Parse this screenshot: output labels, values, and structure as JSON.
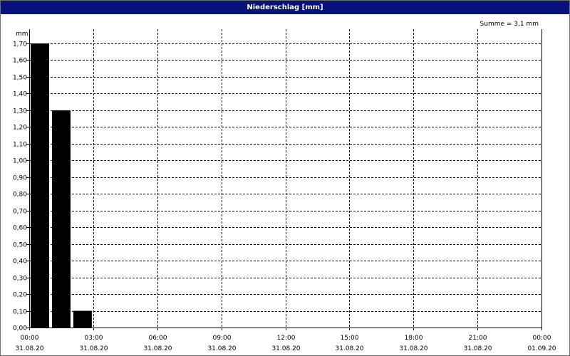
{
  "window": {
    "title": "Niederschlag [mm]"
  },
  "summary": "Summe = 3,1 mm",
  "chart_data": {
    "type": "bar",
    "title": "Niederschlag [mm]",
    "ylabel": "mm",
    "xlabel": "",
    "ylim": [
      0,
      1.7
    ],
    "ytick_step": 0.1,
    "yticks": [
      "0,00",
      "0,10",
      "0,20",
      "0,30",
      "0,40",
      "0,50",
      "0,60",
      "0,70",
      "0,80",
      "0,90",
      "1,00",
      "1,10",
      "1,20",
      "1,30",
      "1,40",
      "1,50",
      "1,60",
      "1,70"
    ],
    "xrange_hours": [
      0,
      24
    ],
    "xticks": [
      {
        "time": "00:00",
        "date": "31.08.20"
      },
      {
        "time": "03:00",
        "date": "31.08.20"
      },
      {
        "time": "06:00",
        "date": "31.08.20"
      },
      {
        "time": "09:00",
        "date": "31.08.20"
      },
      {
        "time": "12:00",
        "date": "31.08.20"
      },
      {
        "time": "15:00",
        "date": "31.08.20"
      },
      {
        "time": "18:00",
        "date": "31.08.20"
      },
      {
        "time": "21:00",
        "date": "31.08.20"
      },
      {
        "time": "00:00",
        "date": "01.09.20"
      }
    ],
    "categories": [
      "00:00-01:00",
      "01:00-02:00",
      "02:00-03:00"
    ],
    "bar_start_hours": [
      0,
      1,
      2
    ],
    "values": [
      1.7,
      1.3,
      0.1
    ],
    "bar_color": "#000000",
    "grid": true
  }
}
